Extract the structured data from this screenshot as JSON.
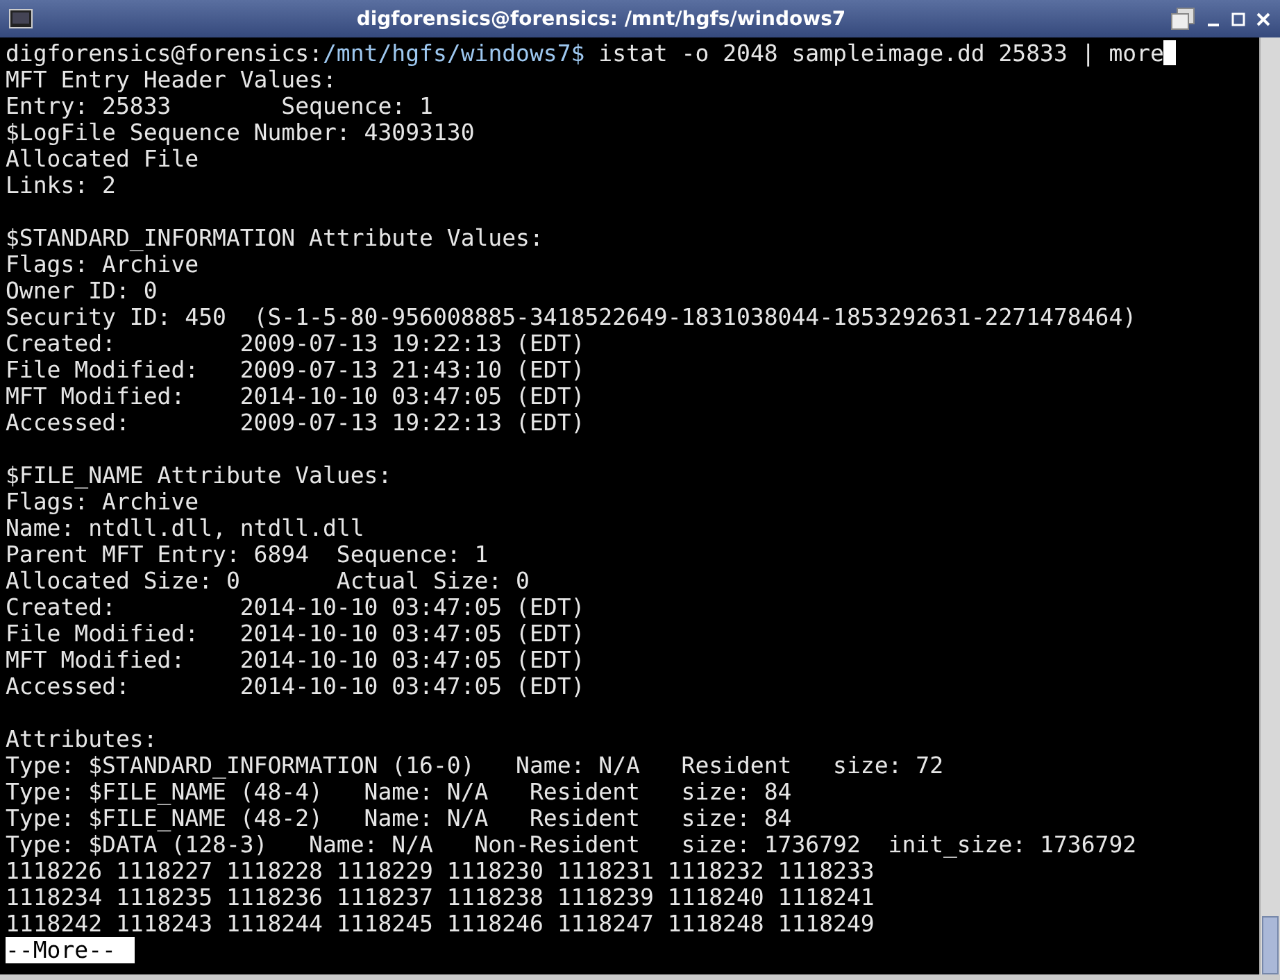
{
  "window": {
    "title": "digforensics@forensics: /mnt/hgfs/windows7"
  },
  "prompt": {
    "user_host": "digforensics@forensics:",
    "path": "/mnt/hgfs/windows7$",
    "command": " istat -o 2048 sampleimage.dd 25833 | more"
  },
  "sections": [
    [
      "MFT Entry Header Values:",
      "Entry: 25833        Sequence: 1",
      "$LogFile Sequence Number: 43093130",
      "Allocated File",
      "Links: 2"
    ],
    [
      "$STANDARD_INFORMATION Attribute Values:",
      "Flags: Archive",
      "Owner ID: 0",
      "Security ID: 450  (S-1-5-80-956008885-3418522649-1831038044-1853292631-2271478464)",
      "Created:         2009-07-13 19:22:13 (EDT)",
      "File Modified:   2009-07-13 21:43:10 (EDT)",
      "MFT Modified:    2014-10-10 03:47:05 (EDT)",
      "Accessed:        2009-07-13 19:22:13 (EDT)"
    ],
    [
      "$FILE_NAME Attribute Values:",
      "Flags: Archive",
      "Name: ntdll.dll, ntdll.dll",
      "Parent MFT Entry: 6894  Sequence: 1",
      "Allocated Size: 0       Actual Size: 0",
      "Created:         2014-10-10 03:47:05 (EDT)",
      "File Modified:   2014-10-10 03:47:05 (EDT)",
      "MFT Modified:    2014-10-10 03:47:05 (EDT)",
      "Accessed:        2014-10-10 03:47:05 (EDT)"
    ],
    [
      "Attributes:",
      "Type: $STANDARD_INFORMATION (16-0)   Name: N/A   Resident   size: 72",
      "Type: $FILE_NAME (48-4)   Name: N/A   Resident   size: 84",
      "Type: $FILE_NAME (48-2)   Name: N/A   Resident   size: 84",
      "Type: $DATA (128-3)   Name: N/A   Non-Resident   size: 1736792  init_size: 1736792",
      "1118226 1118227 1118228 1118229 1118230 1118231 1118232 1118233",
      "1118234 1118235 1118236 1118237 1118238 1118239 1118240 1118241",
      "1118242 1118243 1118244 1118245 1118246 1118247 1118248 1118249"
    ]
  ],
  "pager": "--More--"
}
